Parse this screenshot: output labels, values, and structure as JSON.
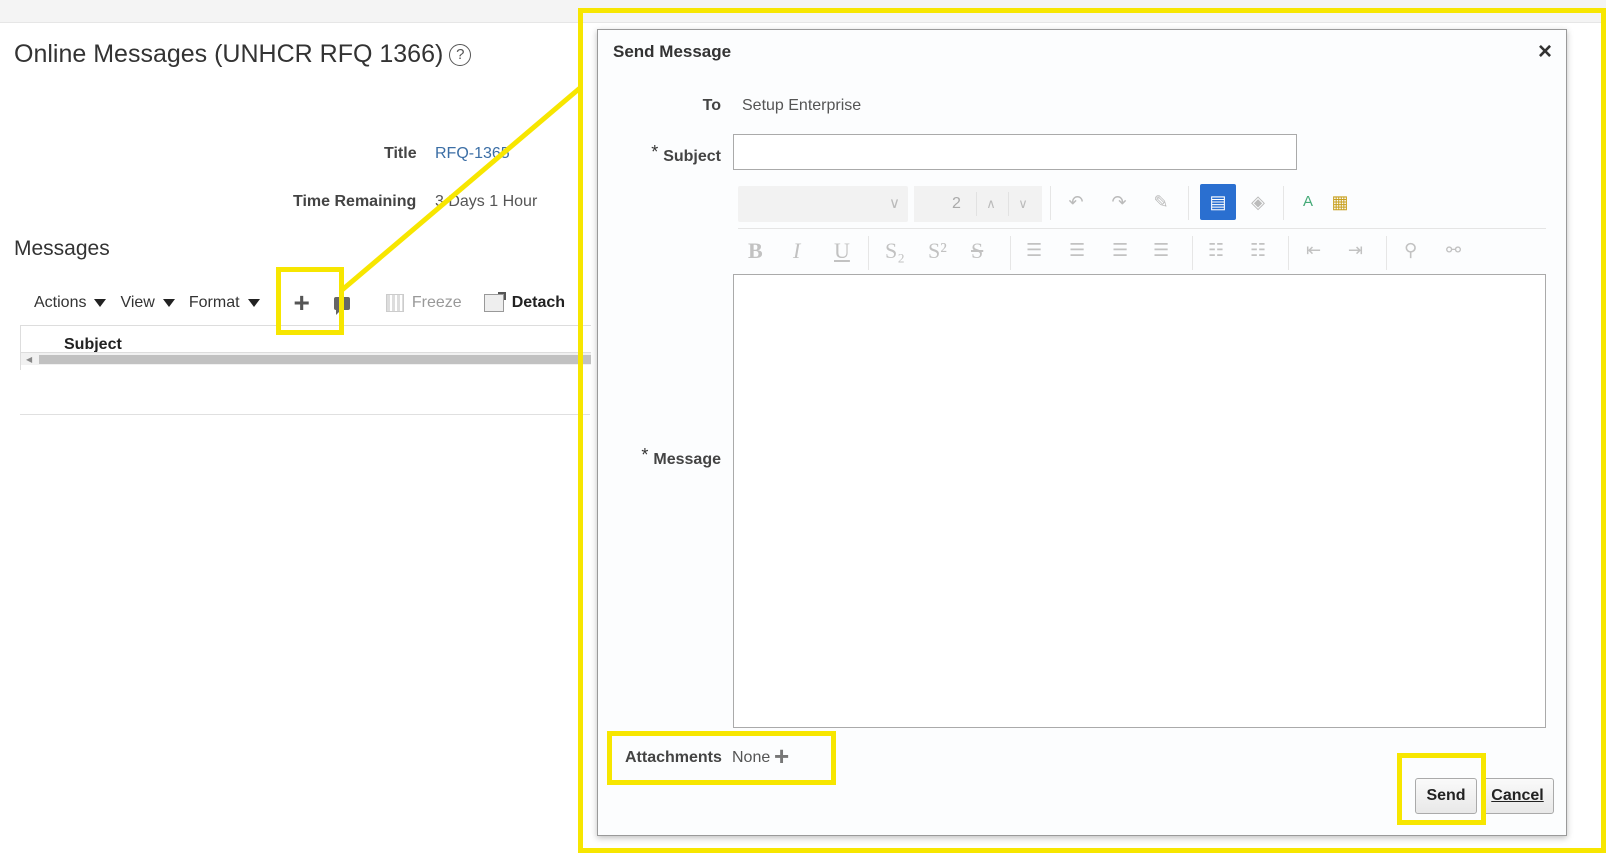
{
  "page": {
    "title": "Online Messages (UNHCR RFQ 1366)",
    "help_icon": "?",
    "title_label": "Title",
    "title_value": "RFQ-1365",
    "time_label": "Time Remaining",
    "time_value": "3 Days 1 Hour",
    "messages_heading": "Messages",
    "table_column_subject": "Subject"
  },
  "toolbar": {
    "actions": "Actions",
    "view": "View",
    "format": "Format",
    "freeze": "Freeze",
    "detach": "Detach",
    "icons": [
      "add-icon",
      "comment-icon",
      "freeze-icon",
      "detach-icon"
    ]
  },
  "dialog": {
    "title": "Send Message",
    "close": "×",
    "to_label": "To",
    "to_value": "Setup Enterprise",
    "subject_label": "Subject",
    "subject_value": "",
    "message_label": "Message",
    "font_size": "2",
    "format_buttons": [
      "B",
      "I",
      "U",
      "S₂",
      "S²",
      "S"
    ],
    "attachments_label": "Attachments",
    "attachments_value": "None",
    "send": "Send",
    "cancel": "Cancel",
    "required_marker": "*"
  },
  "colors": {
    "highlight": "#f7e600",
    "link": "#3b6ea5",
    "rte_active": "#2a6fd0"
  }
}
